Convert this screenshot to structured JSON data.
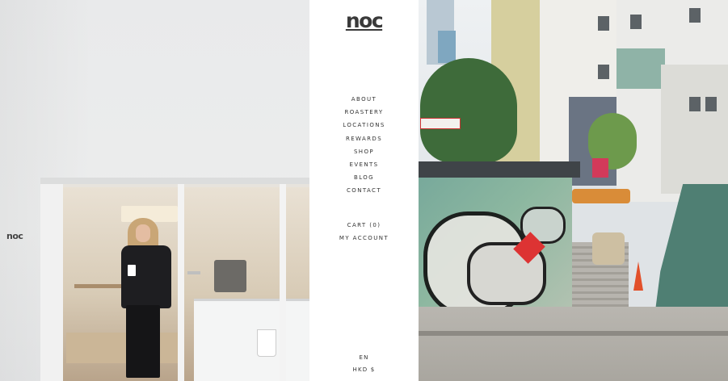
{
  "brand": {
    "logo_text": "noc",
    "wall_logo_text": "noc"
  },
  "nav": {
    "items": [
      {
        "label": "ABOUT"
      },
      {
        "label": "ROASTERY"
      },
      {
        "label": "LOCATIONS"
      },
      {
        "label": "REWARDS"
      },
      {
        "label": "SHOP"
      },
      {
        "label": "EVENTS"
      },
      {
        "label": "BLOG"
      },
      {
        "label": "CONTACT"
      }
    ]
  },
  "account": {
    "cart_label": "CART (0)",
    "my_account_label": "MY ACCOUNT"
  },
  "locale": {
    "language": "EN",
    "currency": "HKD $"
  },
  "colors": {
    "text": "#333333",
    "background": "#ffffff"
  }
}
